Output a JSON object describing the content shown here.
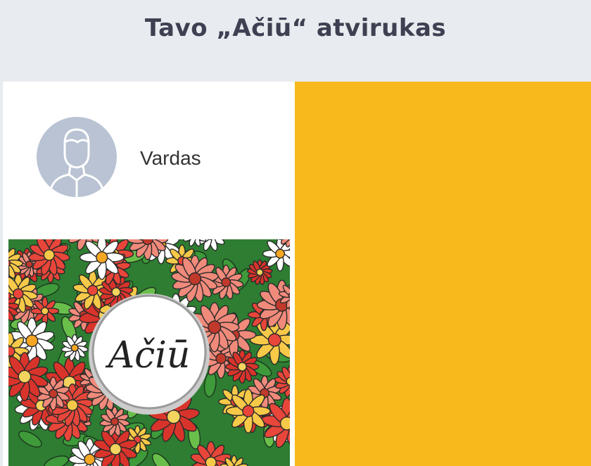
{
  "header": {
    "title": "Tavo „Ačiū“ atvirukas"
  },
  "profile": {
    "name": "Vardas",
    "avatar_icon": "user-avatar-icon"
  },
  "card": {
    "handwritten_text": "Ačiū"
  },
  "colors": {
    "background": "#e8ebef",
    "panel": "#f7b91c",
    "avatar": "#b9c3d3",
    "title": "#3d4152"
  }
}
